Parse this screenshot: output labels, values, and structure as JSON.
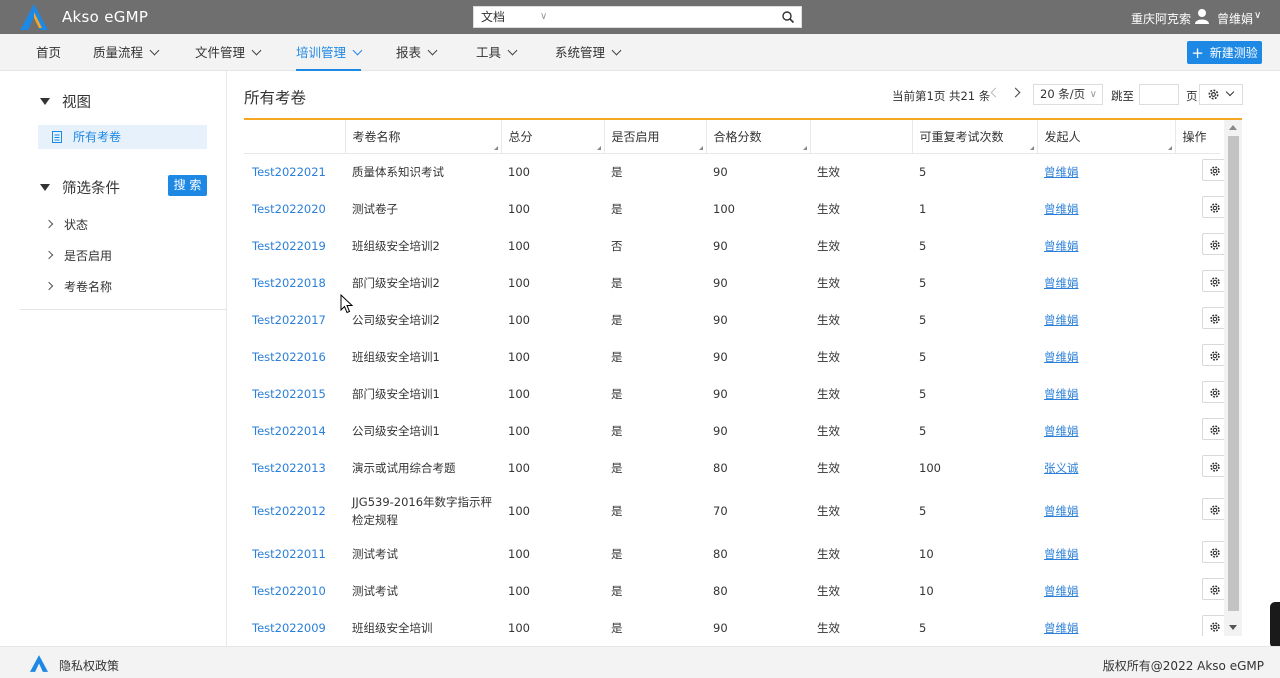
{
  "header": {
    "app_title": "Akso eGMP",
    "search_scope": "文档",
    "search_value": "",
    "company": "重庆阿克索",
    "user_name": "曾维娟"
  },
  "nav": {
    "items": [
      {
        "label": "首页"
      },
      {
        "label": "质量流程"
      },
      {
        "label": "文件管理"
      },
      {
        "label": "培训管理"
      },
      {
        "label": "报表"
      },
      {
        "label": "工具"
      },
      {
        "label": "系统管理"
      }
    ],
    "active": "培训管理",
    "new_button": "新建测验"
  },
  "sidebar": {
    "view_title": "视图",
    "view_item": "所有考卷",
    "filter_title": "筛选条件",
    "search_button": "搜 索",
    "filters": [
      "状态",
      "是否启用",
      "考卷名称"
    ]
  },
  "main": {
    "title": "所有考卷",
    "pager_info": "当前第1页 共21 条",
    "page_size": "20 条/页",
    "jump_label": "跳至",
    "page_label": "页",
    "columns": [
      "",
      "考卷名称",
      "总分",
      "是否启用",
      "合格分数",
      "",
      "可重复考试次数",
      "发起人",
      "操作"
    ],
    "rows": [
      {
        "code": "Test2022021",
        "name": "质量体系知识考试",
        "total": "100",
        "enabled": "是",
        "pass": "90",
        "status": "生效",
        "repeat": "5",
        "user": "曾维娟"
      },
      {
        "code": "Test2022020",
        "name": "测试卷子",
        "total": "100",
        "enabled": "是",
        "pass": "100",
        "status": "生效",
        "repeat": "1",
        "user": "曾维娟"
      },
      {
        "code": "Test2022019",
        "name": "班组级安全培训2",
        "total": "100",
        "enabled": "否",
        "pass": "90",
        "status": "生效",
        "repeat": "5",
        "user": "曾维娟"
      },
      {
        "code": "Test2022018",
        "name": "部门级安全培训2",
        "total": "100",
        "enabled": "是",
        "pass": "90",
        "status": "生效",
        "repeat": "5",
        "user": "曾维娟"
      },
      {
        "code": "Test2022017",
        "name": "公司级安全培训2",
        "total": "100",
        "enabled": "是",
        "pass": "90",
        "status": "生效",
        "repeat": "5",
        "user": "曾维娟"
      },
      {
        "code": "Test2022016",
        "name": "班组级安全培训1",
        "total": "100",
        "enabled": "是",
        "pass": "90",
        "status": "生效",
        "repeat": "5",
        "user": "曾维娟"
      },
      {
        "code": "Test2022015",
        "name": "部门级安全培训1",
        "total": "100",
        "enabled": "是",
        "pass": "90",
        "status": "生效",
        "repeat": "5",
        "user": "曾维娟"
      },
      {
        "code": "Test2022014",
        "name": "公司级安全培训1",
        "total": "100",
        "enabled": "是",
        "pass": "90",
        "status": "生效",
        "repeat": "5",
        "user": "曾维娟"
      },
      {
        "code": "Test2022013",
        "name": "演示或试用综合考题",
        "total": "100",
        "enabled": "是",
        "pass": "80",
        "status": "生效",
        "repeat": "100",
        "user": "张义诚"
      },
      {
        "code": "Test2022012",
        "name": "JJG539-2016年数字指示秤检定规程",
        "total": "100",
        "enabled": "是",
        "pass": "70",
        "status": "生效",
        "repeat": "5",
        "user": "曾维娟"
      },
      {
        "code": "Test2022011",
        "name": "测试考试",
        "total": "100",
        "enabled": "是",
        "pass": "80",
        "status": "生效",
        "repeat": "10",
        "user": "曾维娟"
      },
      {
        "code": "Test2022010",
        "name": "测试考试",
        "total": "100",
        "enabled": "是",
        "pass": "80",
        "status": "生效",
        "repeat": "10",
        "user": "曾维娟"
      },
      {
        "code": "Test2022009",
        "name": "班组级安全培训",
        "total": "100",
        "enabled": "是",
        "pass": "90",
        "status": "生效",
        "repeat": "5",
        "user": "曾维娟"
      }
    ]
  },
  "footer": {
    "privacy": "隐私权政策",
    "copyright": "版权所有@2022 Akso eGMP"
  },
  "colors": {
    "accent": "#1e88e5",
    "link": "#2b7fd8",
    "table_top_border": "#f5a623",
    "topbar": "#6f6f6f"
  },
  "icons": [
    "akso-logo-icon",
    "search-icon",
    "user-icon",
    "chevron-down-icon",
    "plus-icon",
    "document-icon",
    "gear-icon",
    "chevron-left-icon",
    "chevron-right-icon"
  ]
}
